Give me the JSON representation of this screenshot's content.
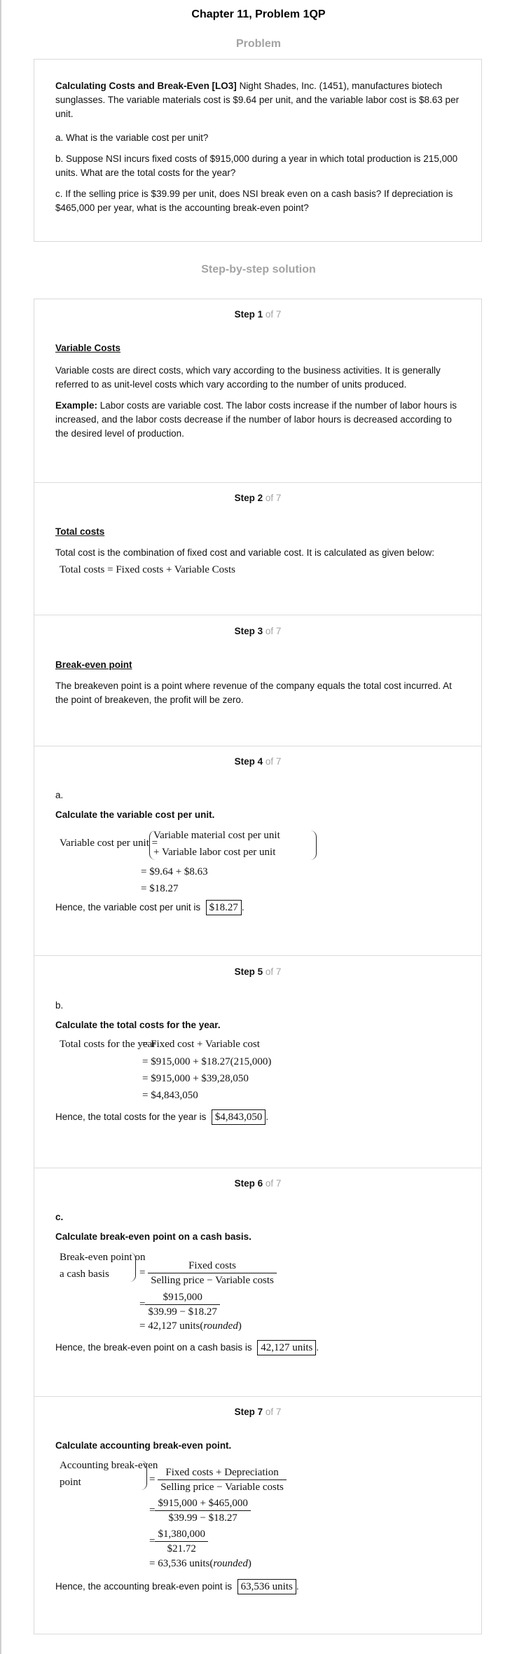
{
  "title": "Chapter 11, Problem 1QP",
  "problem_section": {
    "heading": "Problem",
    "intro_bold": "Calculating Costs and Break-Even [LO3]",
    "intro_text": " Night Shades, Inc. (1451), manufactures biotech sunglasses. The variable materials cost is $9.64 per unit, and the variable labor cost is $8.63 per unit.",
    "part_a": "a. What is the variable cost per unit?",
    "part_b": "b. Suppose NSI incurs fixed costs of $915,000 during a year in which total production is 215,000 units. What are the total costs for the year?",
    "part_c": "c. If the selling price is $39.99 per unit, does NSI break even on a cash basis? If depreciation is $465,000 per year, what is the accounting break-even point?"
  },
  "solution_section": {
    "heading": "Step-by-step solution"
  },
  "steps": [
    {
      "label": "Step 1",
      "of": "of 7",
      "heading": "Variable Costs",
      "text": "Variable costs are direct costs, which vary according to the business activities. It is generally referred to as unit-level costs which vary according to the number of units produced.",
      "example_bold": "Example:",
      "example_text": " Labor costs are variable cost. The labor costs increase if the number of labor hours is increased, and the labor costs decrease if the number of labor hours is decreased according to the desired level of production."
    },
    {
      "label": "Step 2",
      "of": "of 7",
      "heading": "Total costs",
      "text": "Total cost is the combination of fixed cost and variable cost. It is calculated as given below:",
      "formula": "Total costs = Fixed costs + Variable Costs"
    },
    {
      "label": "Step 3",
      "of": "of 7",
      "heading": "Break-even point",
      "text": "The breakeven point is a point where revenue of the company equals the total cost incurred. At the point of breakeven, the profit will be zero."
    },
    {
      "label": "Step 4",
      "of": "of 7",
      "part": "a.",
      "bold": "Calculate the variable cost per unit.",
      "lhs": "Variable cost per unit =",
      "term1": "Variable material cost per unit",
      "term2": "+ Variable labor cost per unit",
      "line2": "= $9.64 + $8.63",
      "line3": "= $18.27",
      "conclusion": "Hence, the variable cost per unit is",
      "answer": "$18.27",
      "period": "."
    },
    {
      "label": "Step 5",
      "of": "of 7",
      "part": "b.",
      "bold": "Calculate the total costs for the year.",
      "lhs": "Total costs for the year",
      "line1": "= Fixed cost + Variable cost",
      "line2": "= $915,000 + $18.27(215,000)",
      "line3": "= $915,000 + $39,28,050",
      "line4": "= $4,843,050",
      "conclusion": "Hence, the total costs for the year is",
      "answer": "$4,843,050",
      "period": "."
    },
    {
      "label": "Step 6",
      "of": "of 7",
      "part": "c.",
      "bold": "Calculate break-even point on a cash basis.",
      "lhs1": "Break-even point on",
      "lhs2": "a cash basis",
      "eq": "=",
      "num1": "Fixed costs",
      "den1": "Selling price − Variable costs",
      "num2": "$915,000",
      "den2": "$39.99 − $18.27",
      "line3": "= 42,127 units",
      "rounded": "rounded",
      "conclusion": "Hence, the break-even point on a cash basis is",
      "answer": "42,127 units",
      "period": "."
    },
    {
      "label": "Step 7",
      "of": "of 7",
      "bold": "Calculate accounting break-even point.",
      "lhs1": "Accounting break-even",
      "lhs2": "point",
      "eq": "=",
      "num1": "Fixed costs + Depreciation",
      "den1": "Selling price − Variable costs",
      "num2": "$915,000 + $465,000",
      "den2": "$39.99 − $18.27",
      "num3": "$1,380,000",
      "den3": "$21.72",
      "line4": "= 63,536 units",
      "rounded": "rounded",
      "conclusion": "Hence, the accounting break-even point is",
      "answer": "63,536 units",
      "period": "."
    }
  ]
}
